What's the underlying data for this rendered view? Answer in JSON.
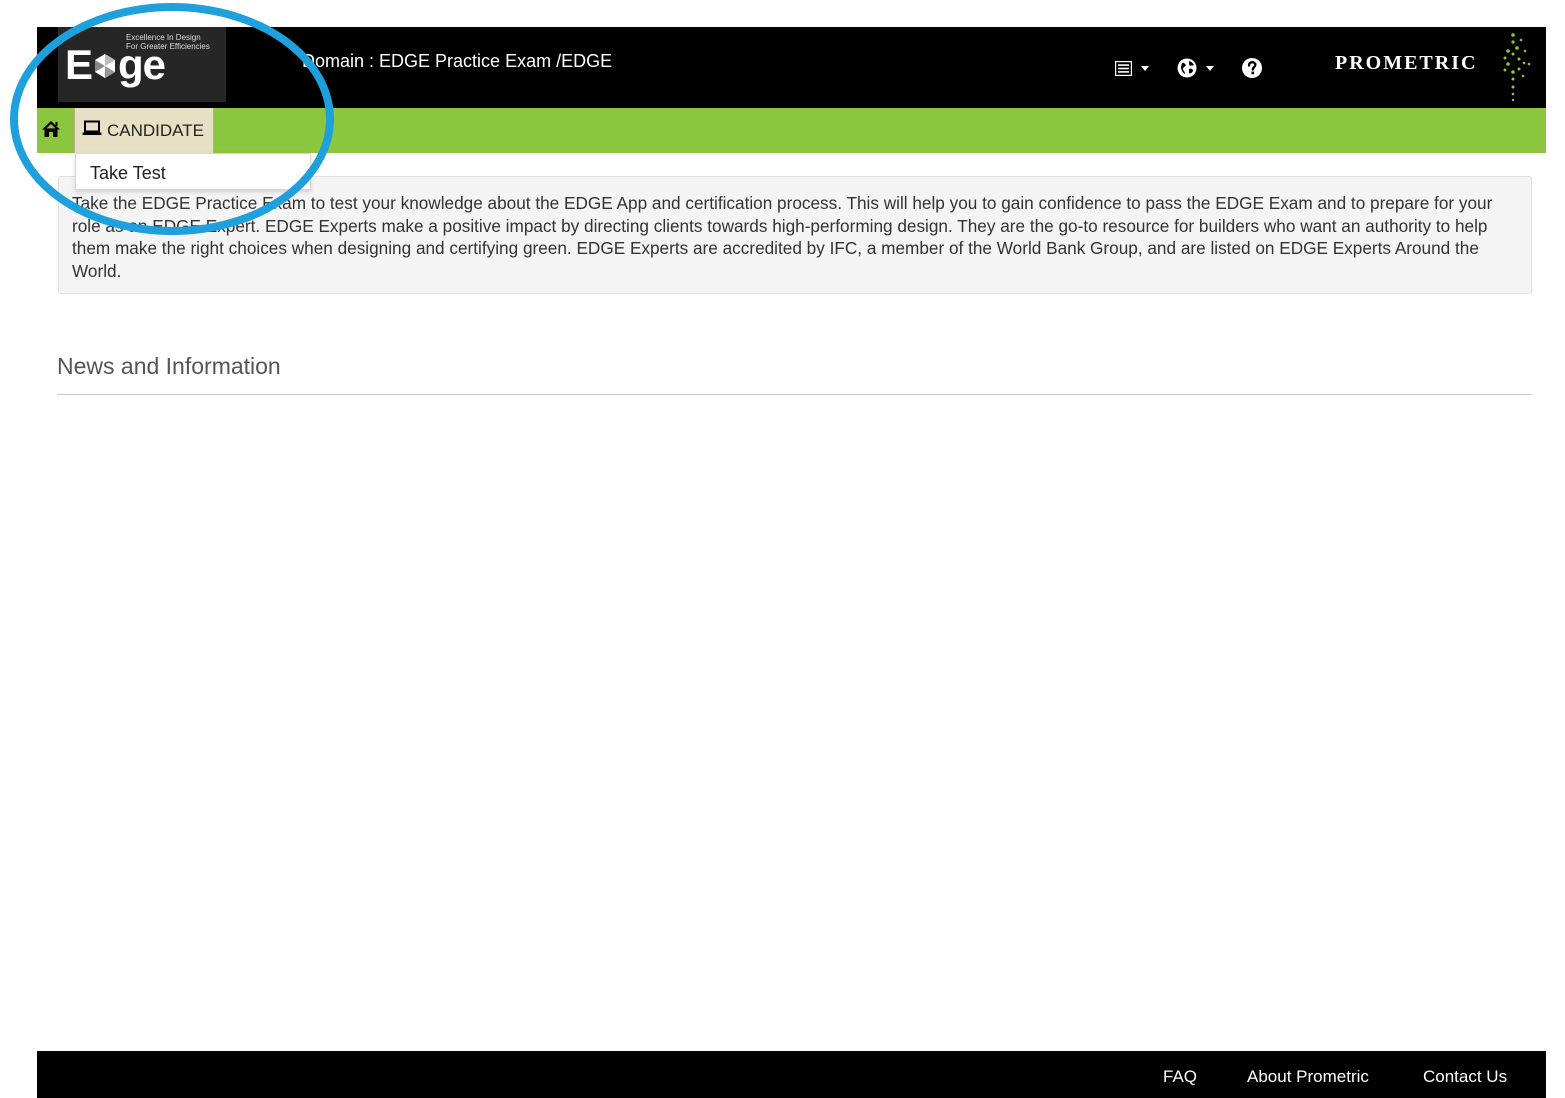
{
  "header": {
    "logo": {
      "wordmark": "Edge",
      "tagline_line1": "Excellence In Design",
      "tagline_line2": "For Greater Efficiencies"
    },
    "domain_text": "Domain : EDGE Practice Exam /EDGE",
    "icons": [
      "menu-list-icon",
      "globe-icon",
      "help-icon"
    ],
    "brand": "PROMETRIC"
  },
  "nav": {
    "home_icon": "home-icon",
    "candidate_label": "CANDIDATE",
    "candidate_icon": "laptop-icon",
    "dropdown_items": [
      "Take Test"
    ]
  },
  "intro_text": "Take the EDGE Practice Exam to test your knowledge about the EDGE App and certification process. This will help you to gain confidence to pass the EDGE Exam and to prepare for your role as an EDGE Expert. EDGE Experts make a positive impact by directing clients towards high-performing design. They are the go-to resource for builders who want an authority to help them make the right choices when designing and certifying green. EDGE Experts are accredited by IFC, a member of the World Bank Group, and are listed on EDGE Experts Around the World.",
  "news": {
    "heading": "News and Information"
  },
  "footer": {
    "links": [
      "FAQ",
      "About Prometric",
      "Contact Us"
    ]
  },
  "colors": {
    "top_bar": "#000000",
    "nav_bar": "#8cc63f",
    "candidate_tab": "#e8e0c4",
    "annotation": "#1ea0dd"
  }
}
